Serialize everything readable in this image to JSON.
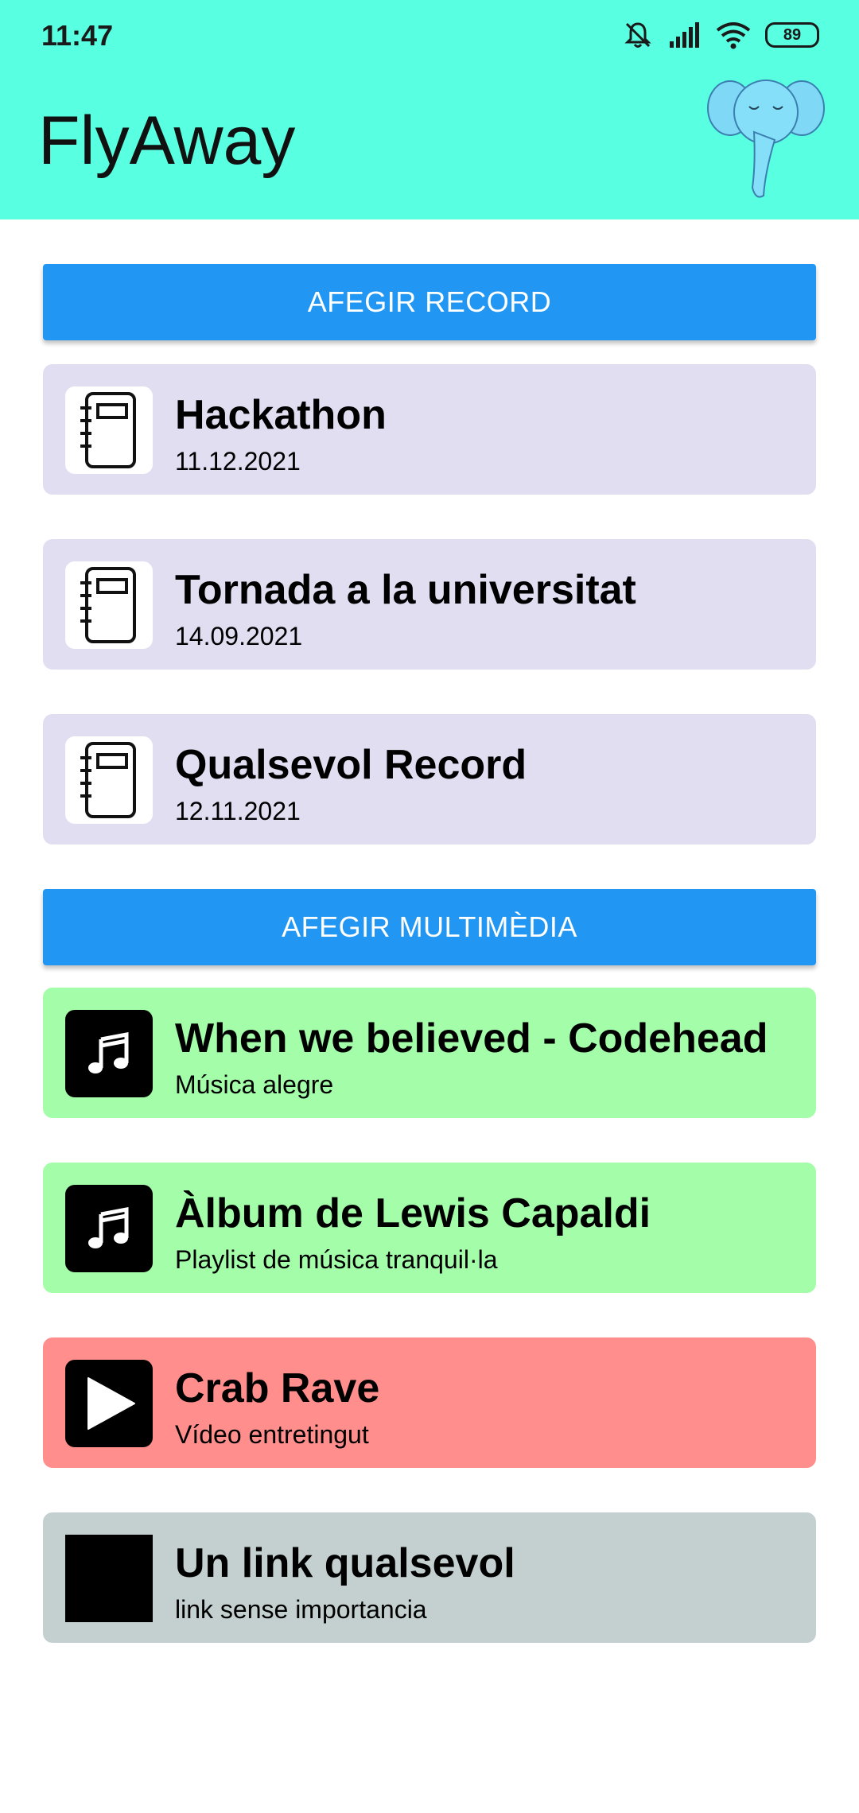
{
  "status_bar": {
    "time": "11:47",
    "battery": "89"
  },
  "app": {
    "title": "FlyAway"
  },
  "records_section": {
    "add_button_label": "AFEGIR RECORD",
    "items": [
      {
        "title": "Hackathon",
        "date": "11.12.2021",
        "icon": "notebook-icon"
      },
      {
        "title": "Tornada a la universitat",
        "date": "14.09.2021",
        "icon": "notebook-icon"
      },
      {
        "title": "Qualsevol Record",
        "date": "12.11.2021",
        "icon": "notebook-icon"
      }
    ]
  },
  "multimedia_section": {
    "add_button_label": "AFEGIR MULTIMÈDIA",
    "items": [
      {
        "title": "When we believed - Codehead",
        "subtitle": "Música alegre",
        "icon": "music-note-icon",
        "color": "#A3FDA9"
      },
      {
        "title": "Àlbum de Lewis Capaldi",
        "subtitle": "Playlist de música tranquil·la",
        "icon": "music-note-icon",
        "color": "#A3FDA9"
      },
      {
        "title": "Crab Rave",
        "subtitle": "Vídeo entretingut",
        "icon": "play-icon",
        "color": "#FF8E8C"
      },
      {
        "title": "Un link qualsevol",
        "subtitle": "link sense importancia",
        "icon": "link-placeholder-icon",
        "color": "#C4D0CF"
      }
    ]
  },
  "colors": {
    "appbar": "#58FFE1",
    "button": "#2196F3",
    "record_card": "#E1DEF1"
  }
}
